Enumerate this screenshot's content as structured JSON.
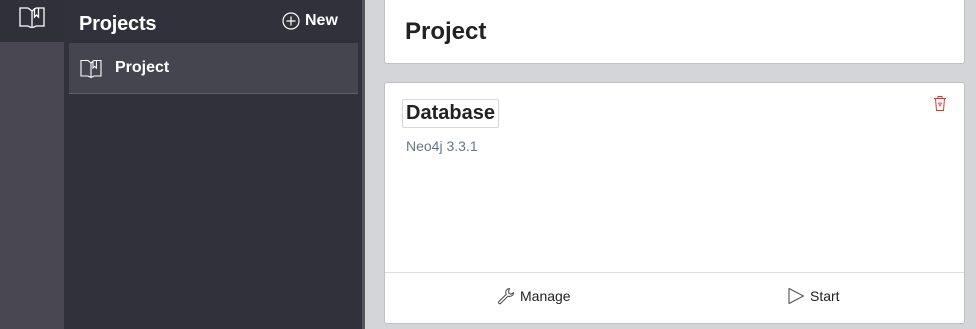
{
  "sidebar": {
    "title": "Projects",
    "new_label": "New",
    "items": [
      {
        "label": "Project"
      }
    ]
  },
  "main": {
    "project_title": "Project",
    "database": {
      "name": "Database",
      "version": "Neo4j 3.3.1",
      "actions": {
        "manage_label": "Manage",
        "start_label": "Start"
      }
    }
  },
  "icons": {
    "rail_projects": "book-icon",
    "new": "plus-circle-icon",
    "project_item": "book-icon",
    "delete": "trash-icon",
    "manage": "wrench-icon",
    "start": "play-icon"
  },
  "colors": {
    "rail": "#484752",
    "sidebar": "#30313a",
    "selected_item": "#44454e",
    "background": "#d4d5d9",
    "version_text": "#657786",
    "delete_icon": "#e0342f"
  }
}
